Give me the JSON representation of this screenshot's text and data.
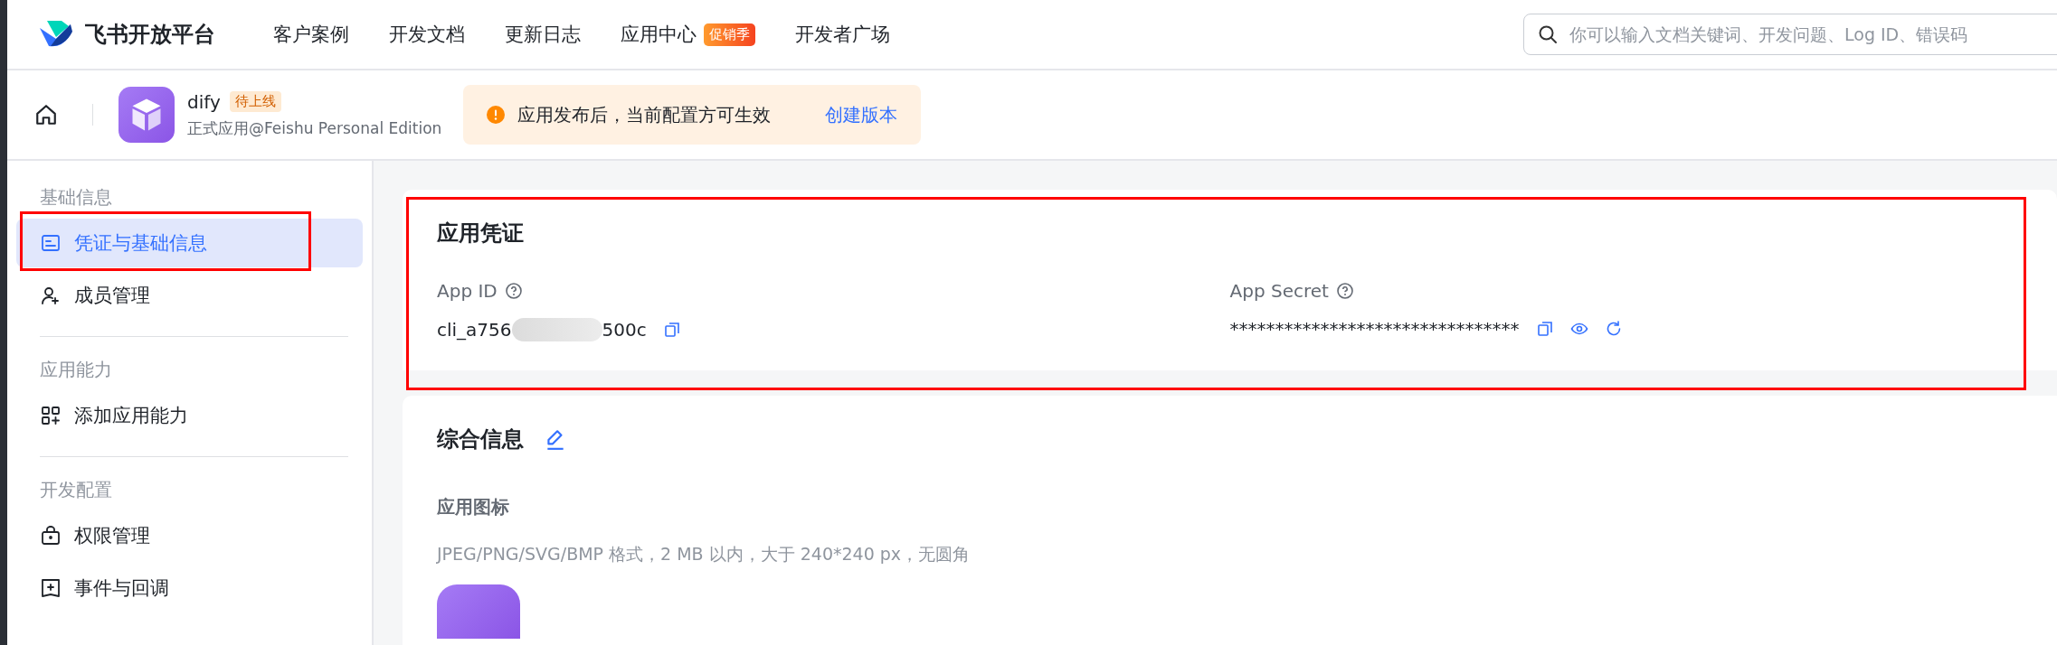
{
  "brand": {
    "name": "飞书开放平台"
  },
  "nav": [
    {
      "label": "客户案例"
    },
    {
      "label": "开发文档"
    },
    {
      "label": "更新日志"
    },
    {
      "label": "应用中心",
      "badge": "促销季"
    },
    {
      "label": "开发者广场"
    }
  ],
  "search": {
    "placeholder": "你可以输入文档关键词、开发问题、Log ID、错误码"
  },
  "app": {
    "name": "dify",
    "status": "待上线",
    "subtitle": "正式应用@Feishu Personal Edition"
  },
  "notice": {
    "text": "应用发布后，当前配置方可生效",
    "link": "创建版本"
  },
  "sidebar": [
    {
      "title": "基础信息",
      "items": [
        {
          "label": "凭证与基础信息",
          "kind": "card",
          "selected": true,
          "highlighted": true
        },
        {
          "label": "成员管理",
          "kind": "user-add",
          "selected": false,
          "highlighted": false
        }
      ]
    },
    {
      "title": "应用能力",
      "items": [
        {
          "label": "添加应用能力",
          "kind": "grid-add",
          "selected": false,
          "highlighted": false
        }
      ]
    },
    {
      "title": "开发配置",
      "items": [
        {
          "label": "权限管理",
          "kind": "bag",
          "selected": false,
          "highlighted": false
        },
        {
          "label": "事件与回调",
          "kind": "square-add",
          "selected": false,
          "highlighted": false
        }
      ]
    }
  ],
  "credentials": {
    "title": "应用凭证",
    "highlighted": true,
    "app_id": {
      "label": "App ID",
      "value_start": "cli_a756",
      "value_end": "500c"
    },
    "app_secret": {
      "label": "App Secret",
      "value": "********************************"
    }
  },
  "general": {
    "title": "综合信息",
    "field_label": "应用图标",
    "hint": "JPEG/PNG/SVG/BMP 格式，2 MB 以内，大于 240*240 px，无圆角"
  }
}
